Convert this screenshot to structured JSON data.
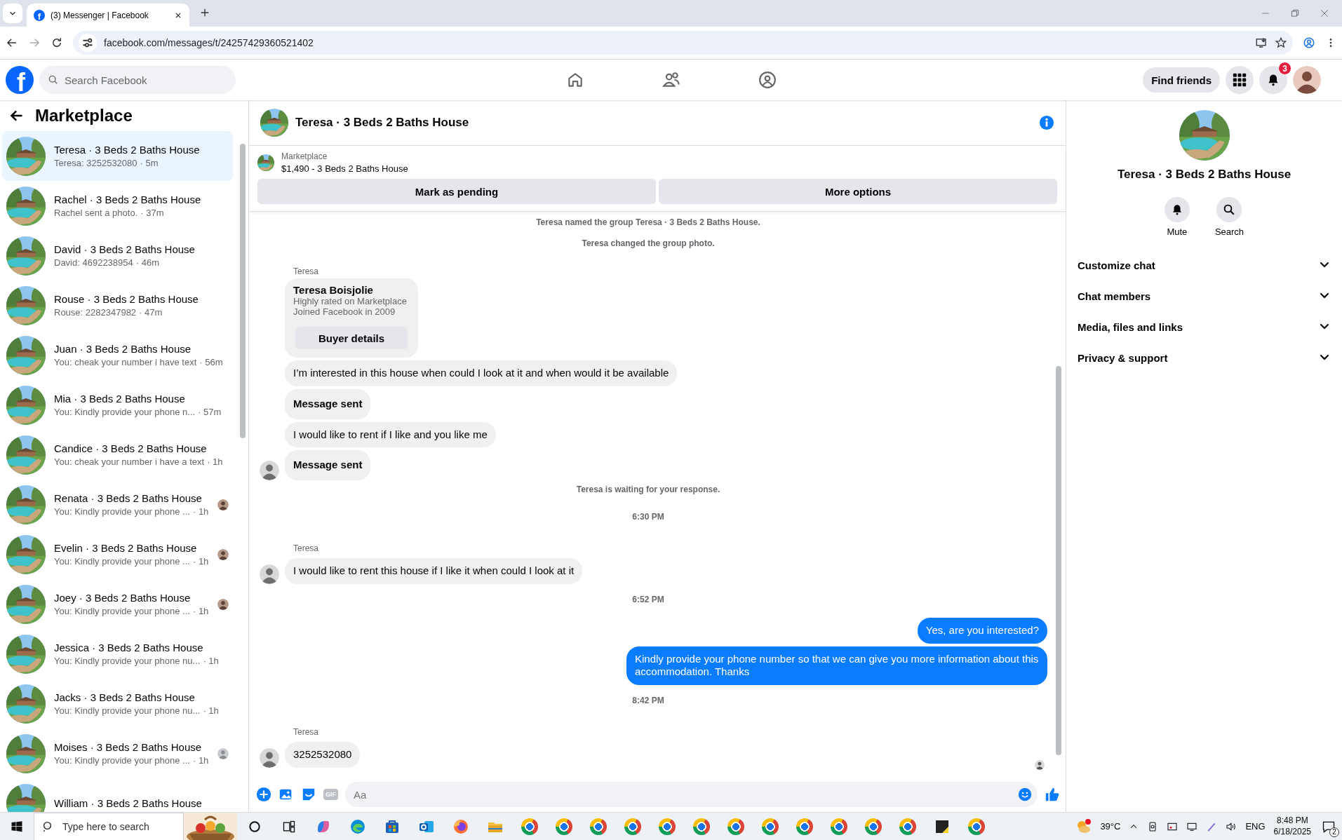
{
  "browser": {
    "favicon_letter": "f",
    "tab_title": "(3) Messenger | Facebook",
    "url": "facebook.com/messages/t/24257429360521402"
  },
  "topnav": {
    "logo_letter": "f",
    "search_placeholder": "Search Facebook",
    "find_friends": "Find friends",
    "notification_count": "3"
  },
  "sidebar": {
    "title": "Marketplace",
    "items": [
      {
        "name": "Teresa · 3 Beds 2 Baths House",
        "preview": "Teresa: 3252532080",
        "time": "· 5m",
        "selected": true
      },
      {
        "name": "Rachel · 3 Beds 2 Baths House",
        "preview": "Rachel sent a photo.",
        "time": "· 37m",
        "selected": false
      },
      {
        "name": "David · 3 Beds 2 Baths House",
        "preview": "David: 4692238954",
        "time": "· 46m",
        "selected": false
      },
      {
        "name": "Rouse · 3 Beds 2 Baths House",
        "preview": "Rouse: 2282347982",
        "time": "· 47m",
        "selected": false
      },
      {
        "name": "Juan · 3 Beds 2 Baths House",
        "preview": "You: cheak your number i have text",
        "time": "· 56m",
        "selected": false
      },
      {
        "name": "Mia · 3 Beds 2 Baths House",
        "preview": "You: Kindly provide your phone n...",
        "time": "· 57m",
        "selected": false
      },
      {
        "name": "Candice · 3 Beds 2 Baths House",
        "preview": "You: cheak your number i have a text",
        "time": "· 1h",
        "selected": false
      },
      {
        "name": "Renata · 3 Beds 2 Baths House",
        "preview": "You: Kindly provide your phone ...",
        "time": "· 1h",
        "selected": false,
        "kind": "seen_photo"
      },
      {
        "name": "Evelin · 3 Beds 2 Baths House",
        "preview": "You: Kindly provide your phone ...",
        "time": "· 1h",
        "selected": false,
        "kind": "seen_photo"
      },
      {
        "name": "Joey · 3 Beds 2 Baths House",
        "preview": "You: Kindly provide your phone ...",
        "time": "· 1h",
        "selected": false,
        "kind": "seen_photo"
      },
      {
        "name": "Jessica · 3 Beds 2 Baths House",
        "preview": "You: Kindly provide your phone nu...",
        "time": "· 1h",
        "selected": false
      },
      {
        "name": "Jacks · 3 Beds 2 Baths House",
        "preview": "You: Kindly provide your phone nu...",
        "time": "· 1h",
        "selected": false
      },
      {
        "name": "Moises · 3 Beds 2 Baths House",
        "preview": "You: Kindly provide your phone ...",
        "time": "· 1h",
        "selected": false,
        "kind": "seen_default"
      },
      {
        "name": "William · 3 Beds 2 Baths House",
        "selected": false
      }
    ]
  },
  "chat": {
    "title": "Teresa · 3 Beds 2 Baths House",
    "listing": {
      "label": "Marketplace",
      "title": "$1,490 - 3 Beds 2 Baths House",
      "buttons": [
        "Mark as pending",
        "More options"
      ]
    },
    "messages": [
      {
        "kind": "system",
        "text": "Teresa named the group Teresa · 3 Beds 2 Baths House."
      },
      {
        "kind": "system",
        "text": "Teresa changed the group photo."
      },
      {
        "kind": "sender",
        "text": "Teresa"
      },
      {
        "kind": "card",
        "name": "Teresa Boisjolie",
        "lines": [
          "Highly rated on Marketplace",
          "Joined Facebook in 2009"
        ],
        "button": "Buyer details"
      },
      {
        "kind": "incoming",
        "text": "I’m interested in this house when could I look at it and when would it be available",
        "avatar": false
      },
      {
        "kind": "notice",
        "text": "Message sent",
        "avatar": false
      },
      {
        "kind": "incoming",
        "text": "I would like to rent if I like and you like me",
        "avatar": false
      },
      {
        "kind": "notice",
        "text": "Message sent",
        "avatar": true
      },
      {
        "kind": "system",
        "text": "Teresa is waiting for your response."
      },
      {
        "kind": "time",
        "text": "6:30 PM"
      },
      {
        "kind": "sender",
        "text": "Teresa"
      },
      {
        "kind": "incoming",
        "text": "I would like to rent this house if I like it when could I look at it",
        "avatar": true
      },
      {
        "kind": "time",
        "text": "6:52 PM"
      },
      {
        "kind": "outgoing",
        "text": "Yes, are you interested?"
      },
      {
        "kind": "outgoing",
        "text": "Kindly provide your phone number so that we can give you more information about this accommodation. Thanks"
      },
      {
        "kind": "time",
        "text": "8:42 PM"
      },
      {
        "kind": "sender",
        "text": "Teresa"
      },
      {
        "kind": "incoming",
        "text": "3252532080",
        "avatar": true
      }
    ],
    "seen": true,
    "composer": {
      "gif_label": "GIF",
      "placeholder": "Aa"
    }
  },
  "details": {
    "title": "Teresa · 3 Beds 2 Baths House",
    "actions": [
      {
        "kind": "mute",
        "label": "Mute"
      },
      {
        "kind": "search",
        "label": "Search"
      }
    ],
    "sections": [
      {
        "label": "Customize chat",
        "expanded": false
      },
      {
        "label": "Chat members",
        "expanded": false
      },
      {
        "label": "Media, files and links",
        "expanded": false
      },
      {
        "label": "Privacy & support",
        "expanded": false
      }
    ]
  },
  "taskbar": {
    "search_placeholder": "Type here to search",
    "temperature": "39°C",
    "language": "ENG",
    "time": "8:48 PM",
    "date": "6/18/2025",
    "notification_count": "2"
  }
}
